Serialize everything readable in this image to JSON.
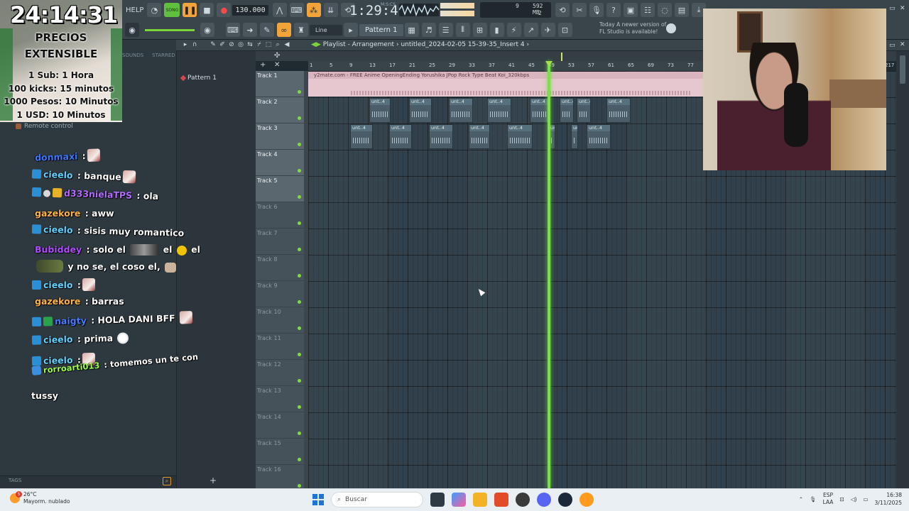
{
  "timer": {
    "clock": "24:14:31",
    "line1": "PRECIOS",
    "line2": "EXTENSIBLE",
    "line3": "1 Sub: 1 Hora",
    "line4": "100 kicks: 15 minutos",
    "line5": "1000 Pesos: 10 Minutos",
    "line6": "1 USD: 10 Minutos"
  },
  "fl": {
    "help": "HELP",
    "song_mode": "SONG",
    "tempo": "130.000",
    "time": "1:29:41",
    "time_unit": "M:S:CS",
    "cpu_mem": "592 MB",
    "cpu_n1": "9",
    "cpu_n2": "2",
    "snap": "Line",
    "pattern": "Pattern 1",
    "news_1": "Today  A newer version of",
    "news_2": "FL Studio is available!",
    "browser_tab_1": "SOUNDS",
    "browser_tab_2": "STARRED",
    "remote_control": "Remote control",
    "tags": "TAGS",
    "picker_item": "Pattern 1",
    "playlist_title": "Playlist - Arrangement",
    "playlist_path": "untitled_2024-02-05 15-39-35_Insert 4",
    "audio_clip_label": "y2mate.com - FREE Anime OpeningEnding Yorushika JPop Rock Type Beat  Koi_320kbps",
    "clip_label": "unt..4",
    "bar_numbers": [
      "1",
      "5",
      "9",
      "13",
      "17",
      "21",
      "25",
      "29",
      "33",
      "37",
      "41",
      "45",
      "49",
      "53",
      "57",
      "61",
      "65",
      "69",
      "73",
      "77"
    ],
    "tracks": [
      "Track 1",
      "Track 2",
      "Track 3",
      "Track 4",
      "Track 5",
      "Track 6",
      "Track 7",
      "Track 8",
      "Track 9",
      "Track 10",
      "Track 11",
      "Track 12",
      "Track 13",
      "Track 14",
      "Track 15",
      "Track 16"
    ],
    "top_right_num": "217"
  },
  "chat": {
    "m1_user": "donmaxi",
    "m1_text": " :",
    "m2_user": "cieelo",
    "m2_text": " : banque",
    "m3_user": "d333nielaTPS",
    "m3_text": " : ola",
    "m4_user": "gazekore",
    "m4_text": " : aww",
    "m5_user": "cieelo",
    "m5_text": " : sisis muy romantico",
    "m6_user": "Bubiddey",
    "m6_text": " : solo el",
    "m6_text2": "el",
    "m6_text3": "el",
    "m6_line2": "y no se, el coso el,",
    "m7_user": "cieelo",
    "m7_text": " :",
    "m8_user": "gazekore",
    "m8_text": " : barras",
    "m9_user": "naigty",
    "m9_text": " : HOLA DANI BFF",
    "m10_user": "cieelo",
    "m10_text": " : prima",
    "m11_user": "cieelo",
    "m11_text": " :",
    "m12_user": "rorroarti013",
    "m12_text": " : tomemos un te con",
    "m12_line2": "tussy"
  },
  "colors": {
    "donmaxi": "#3b78ff",
    "cieelo": "#62d2ff",
    "d333nielaTPS": "#b26bff",
    "gazekore": "#ffb347",
    "Bubiddey": "#b04dff",
    "naigty": "#4a7bff",
    "rorroarti013": "#9cff4a"
  },
  "taskbar": {
    "temp": "26°C",
    "weather": "Mayorm. nublado",
    "weather_badge": "5",
    "search": "Buscar",
    "lang1": "ESP",
    "lang2": "LAA",
    "time": "16:38",
    "date": "3/11/2025"
  }
}
